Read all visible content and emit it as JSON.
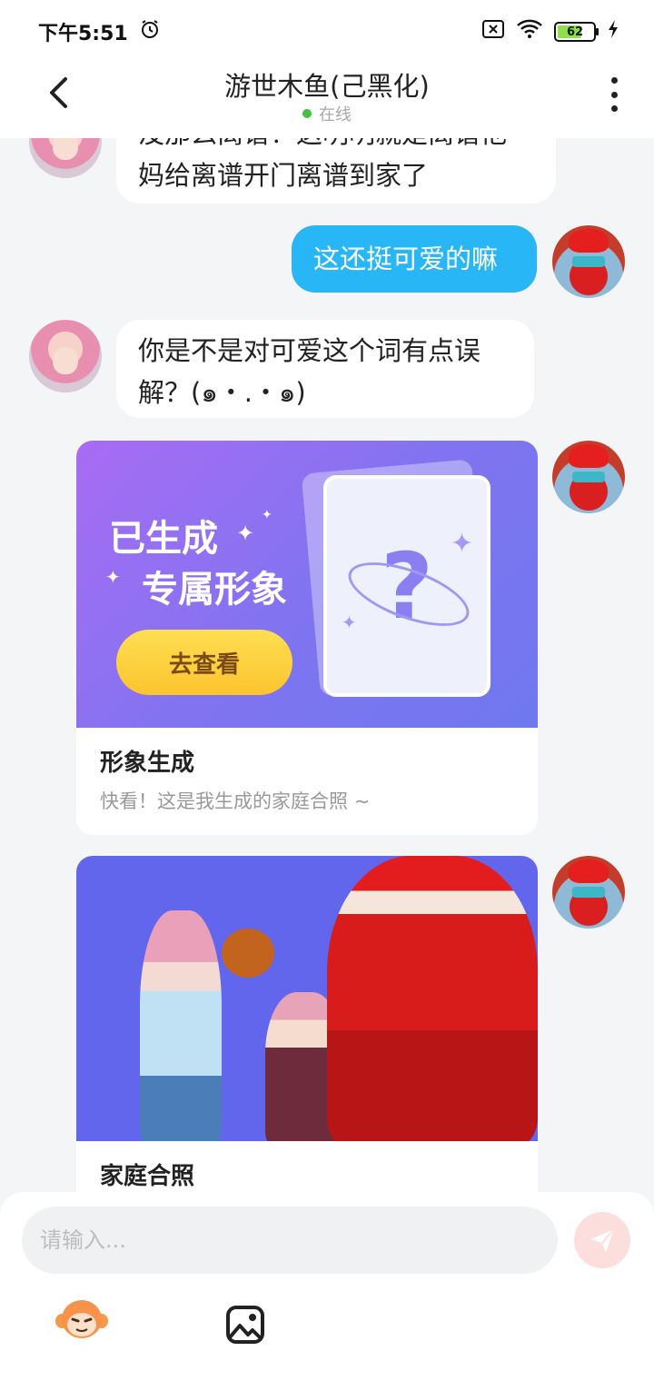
{
  "status_bar": {
    "time": "下午5:51",
    "battery": "62",
    "icons": [
      "alarm-icon",
      "sim-off-icon",
      "wifi-icon",
      "battery-icon",
      "charging-icon"
    ]
  },
  "header": {
    "title": "游世木鱼(己黑化)",
    "status": "在线"
  },
  "messages": [
    {
      "side": "in",
      "text_line1": "没那么离谱！这明明就是离谱他",
      "text_line2": "妈给离谱开门离谱到家了"
    },
    {
      "side": "out",
      "text": "这还挺可爱的嘛"
    },
    {
      "side": "in",
      "text_line1": "你是不是对可爱这个词有点误",
      "text_line2": "解？(๑・.・๑)"
    }
  ],
  "card1": {
    "banner_line1": "已生成",
    "banner_line2": "专属形象",
    "button": "去查看",
    "title": "形象生成",
    "desc": "快看！这是我生成的家庭合照 ~"
  },
  "card2": {
    "title": "家庭合照"
  },
  "input": {
    "placeholder": "请输入..."
  },
  "colors": {
    "accent_blue": "#29b6f6",
    "card_purple": "#8a74f1",
    "button_yellow": "#fdd13d",
    "online_green": "#3ec43e"
  }
}
